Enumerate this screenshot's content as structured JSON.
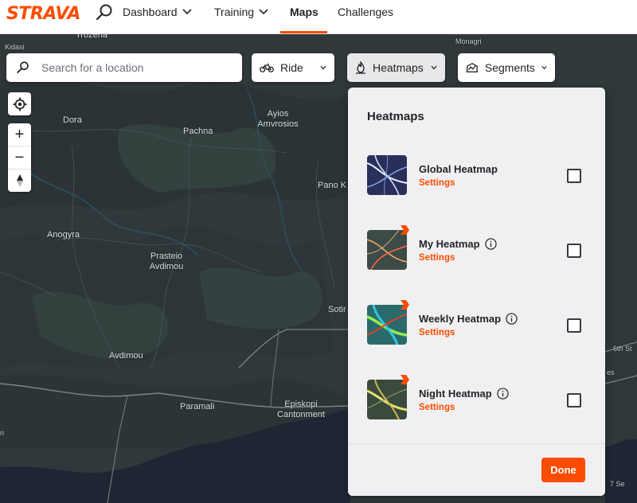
{
  "brand": {
    "logo_text": "STRAVA",
    "accent": "#fc4c02"
  },
  "nav": {
    "items": [
      {
        "label": "Dashboard",
        "has_dropdown": true
      },
      {
        "label": "Training",
        "has_dropdown": true
      },
      {
        "label": "Maps",
        "has_dropdown": false,
        "active": true
      },
      {
        "label": "Challenges",
        "has_dropdown": false
      }
    ]
  },
  "search": {
    "placeholder": "Search for a location",
    "value": ""
  },
  "filters": {
    "sport": {
      "label": "Ride",
      "icon": "bike-icon"
    },
    "heatmaps": {
      "label": "Heatmaps",
      "icon": "heatmap-flame-icon",
      "open": true
    },
    "segments": {
      "label": "Segments",
      "icon": "segments-icon"
    }
  },
  "map_controls": {
    "zoom_in": "+",
    "zoom_out": "−"
  },
  "places": [
    {
      "name": "Kidasi"
    },
    {
      "name": "Trozena"
    },
    {
      "name": "Monagri"
    },
    {
      "name": "Dora"
    },
    {
      "name": "Pachna"
    },
    {
      "name": "Ayios Amvrosios"
    },
    {
      "name": "Pano K"
    },
    {
      "name": "Anogyra"
    },
    {
      "name": "Prasteio Avdimou"
    },
    {
      "name": "Sotir"
    },
    {
      "name": "Avdimou"
    },
    {
      "name": "Paramali"
    },
    {
      "name": "Episkopi Cantonment"
    },
    {
      "name": "6th St"
    },
    {
      "name": "es"
    },
    {
      "name": "ri"
    },
    {
      "name": "7 Se"
    }
  ],
  "heatmaps_panel": {
    "title": "Heatmaps",
    "items": [
      {
        "name": "Global Heatmap",
        "settings_label": "Settings",
        "info": false,
        "premium": false,
        "checked": false
      },
      {
        "name": "My Heatmap",
        "settings_label": "Settings",
        "info": true,
        "premium": true,
        "checked": false
      },
      {
        "name": "Weekly Heatmap",
        "settings_label": "Settings",
        "info": true,
        "premium": true,
        "checked": false
      },
      {
        "name": "Night Heatmap",
        "settings_label": "Settings",
        "info": true,
        "premium": true,
        "checked": false
      }
    ],
    "done_label": "Done"
  }
}
